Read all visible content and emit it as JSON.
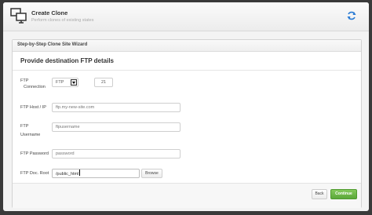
{
  "header": {
    "title": "Create Clone",
    "subtitle": "Perform clones of existing states",
    "icon": "monitors-icon",
    "refresh_icon": "refresh-icon"
  },
  "wizard": {
    "panel_title": "Step-by-Step Clone Site Wizard",
    "section_title": "Provide destination FTP details",
    "fields": {
      "connection": {
        "label_line1": "FTP",
        "label_line2": "Connection",
        "type_value": "FTP",
        "port_value": "21"
      },
      "host": {
        "label": "FTP Host / IP",
        "placeholder": "ftp.my-new-site.com"
      },
      "username": {
        "label_line1": "FTP",
        "label_line2": "Username",
        "placeholder": "ftpusername"
      },
      "password": {
        "label": "FTP Password",
        "placeholder": "password"
      },
      "doc_root": {
        "label": "FTP Doc. Root",
        "value": "/public_html",
        "browse_label": "Browse"
      }
    },
    "footer": {
      "back_label": "Back",
      "continue_label": "Continue"
    }
  },
  "colors": {
    "continue_button": "#5ba83a",
    "background_frame": "#3a3a3a",
    "refresh_icon": "#2a7bd4"
  }
}
